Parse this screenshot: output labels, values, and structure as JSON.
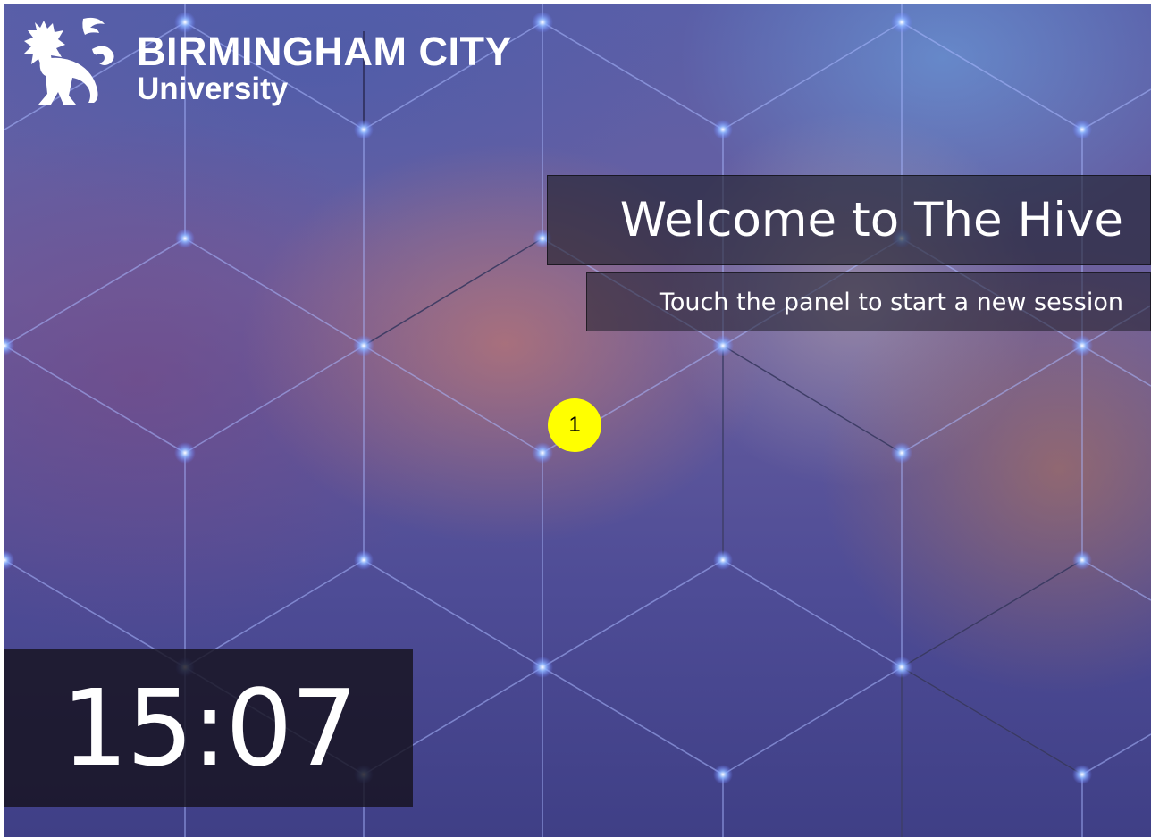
{
  "logo": {
    "name": "BIRMINGHAM CITY",
    "sub": "University",
    "icon": "lion-icon"
  },
  "welcome": {
    "title": "Welcome to The Hive",
    "subtitle": "Touch the panel to start a new session"
  },
  "clock": {
    "time": "15:07"
  },
  "marker": {
    "label": "1"
  }
}
